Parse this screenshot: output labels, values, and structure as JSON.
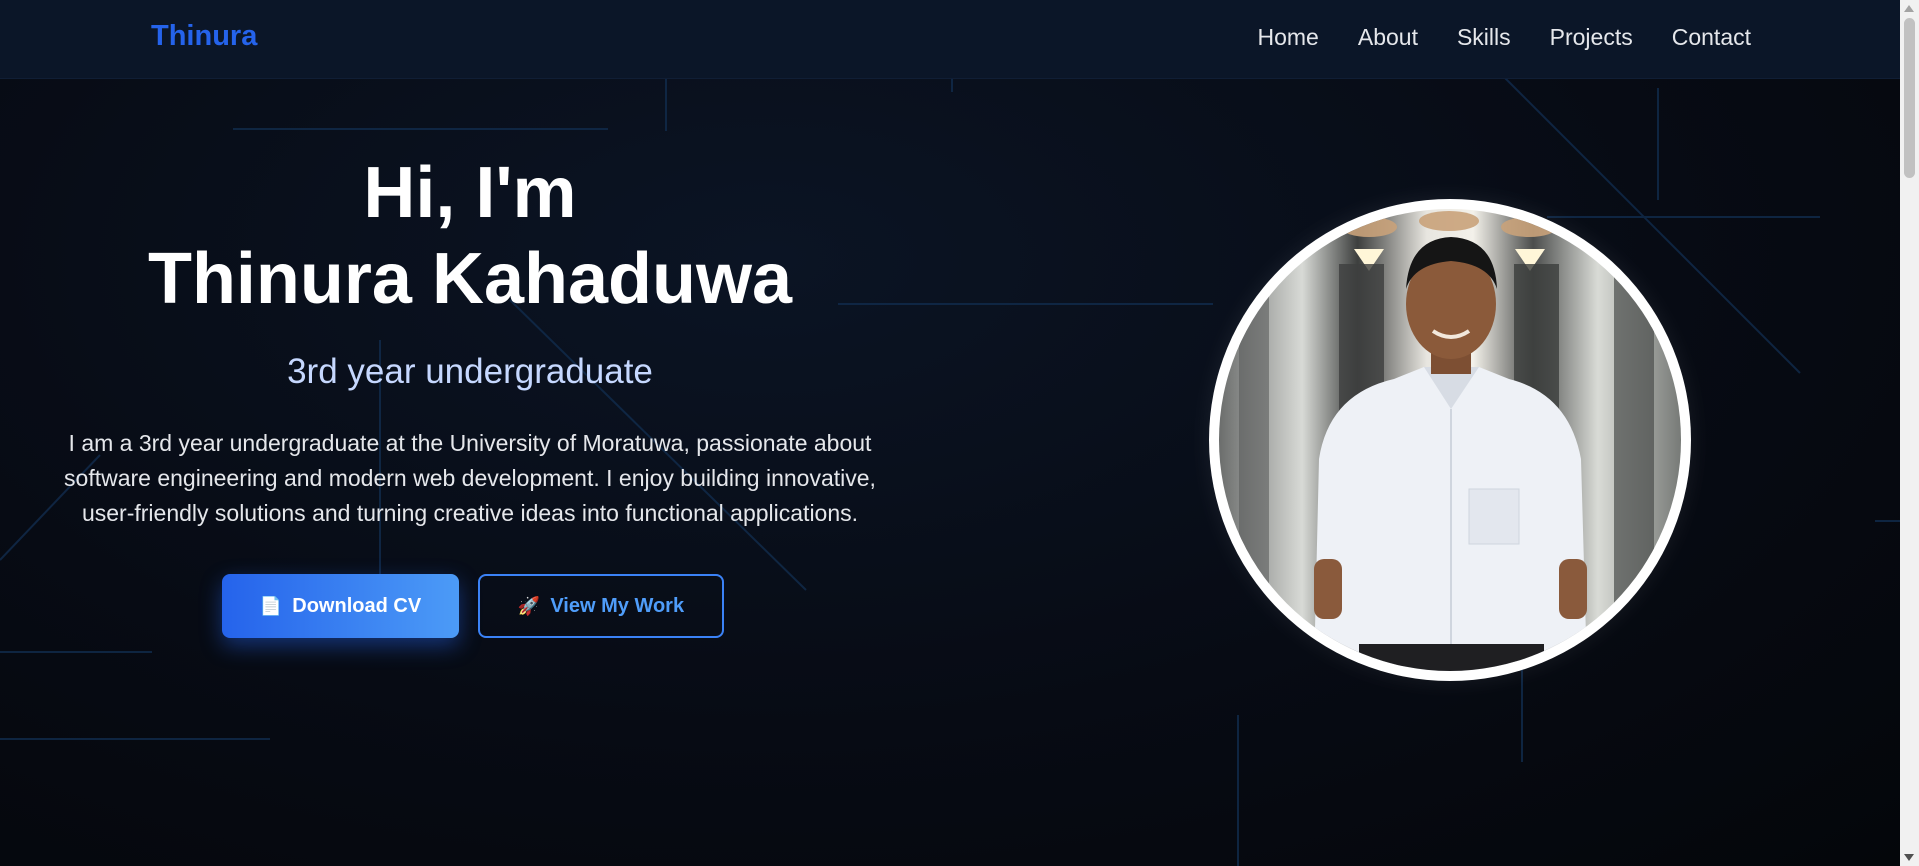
{
  "navbar": {
    "brand": "Thinura",
    "links": [
      "Home",
      "About",
      "Skills",
      "Projects",
      "Contact"
    ]
  },
  "hero": {
    "greeting": "Hi, I'm",
    "name": "Thinura Kahaduwa",
    "subtitle": "3rd year undergraduate",
    "description": "I am a 3rd year undergraduate at the University of Moratuwa, passionate about software engineering and modern web development. I enjoy building innovative, user-friendly solutions and turning creative ideas into functional applications.",
    "buttons": {
      "download_cv": "Download CV",
      "download_icon": "📄",
      "view_work": "View My Work",
      "view_icon": "🚀"
    }
  },
  "colors": {
    "accent": "#2563eb",
    "nav_bg": "#0b1628",
    "page_bg": "#05070d",
    "subtitle": "#c6d8ff"
  },
  "icons": {
    "download_cv": "document-icon",
    "view_work": "rocket-icon"
  }
}
